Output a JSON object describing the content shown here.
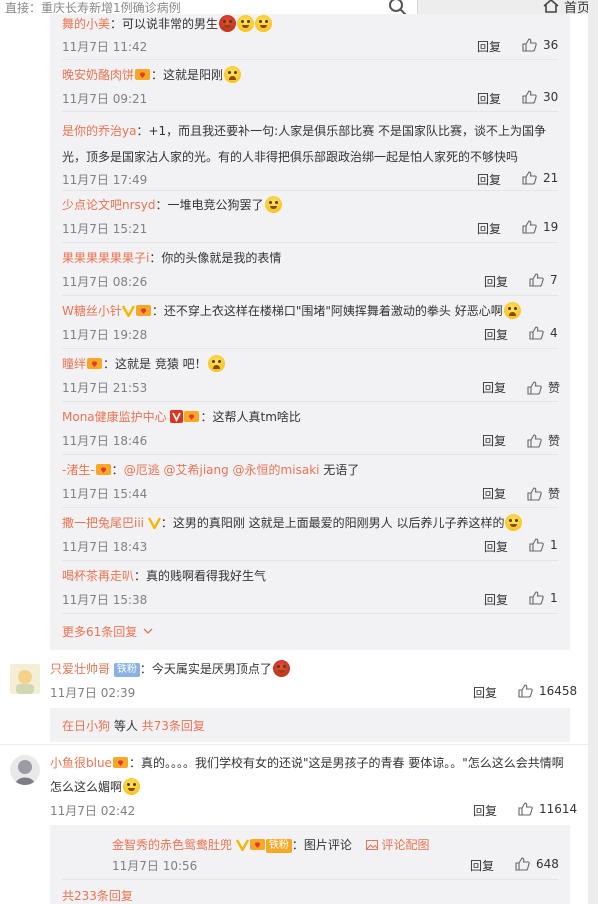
{
  "search": {
    "placeholder": "直接：重庆长寿新增1例确诊病例"
  },
  "header": {
    "home_label": "首页"
  },
  "reply_label": "回复",
  "replies": [
    {
      "user": "舞的小美",
      "text": "：可以说非常的男生",
      "time": "11月7日 11:42",
      "likes": "36"
    },
    {
      "user": "晚安奶酪肉饼",
      "text": "：这就是阳刚",
      "time": "11月7日 09:21",
      "likes": "30"
    },
    {
      "user": "是你的乔治ya",
      "text": "：+1，而且我还要补一句:人家是俱乐部比赛 不是国家队比赛，谈不上为国争光，顶多是国家沾人家的光。有的人非得把俱乐部跟政治绑一起是怕人家死的不够快吗",
      "time": "11月7日 17:49",
      "likes": "21"
    },
    {
      "user": "少点论文吧nrsyd",
      "text": "：一堆电竞公狗罢了",
      "time": "11月7日 15:21",
      "likes": "19"
    },
    {
      "user": "果果果果果果子i",
      "text": "：你的头像就是我的表情",
      "time": "11月7日 08:26",
      "likes": "7"
    },
    {
      "user": "W糖丝小针",
      "text": "：还不穿上衣这样在楼梯口\"围堵\"阿姨挥舞着激动的拳头 好恶心啊",
      "time": "11月7日 19:28",
      "likes": "4"
    },
    {
      "user": "瞳绊",
      "text": "：这就是 竞猿 吧！",
      "time": "11月7日 21:53",
      "likes": "赞"
    },
    {
      "user": "Mona健康监护中心",
      "text": "：这帮人真tm啥比",
      "time": "11月7日 18:46",
      "likes": "赞"
    },
    {
      "user": "-渚生-",
      "text": "：",
      "mentions": "@厄逃 @艾希jiang @永恒的misaki",
      "tail": " 无语了",
      "time": "11月7日 15:44",
      "likes": "赞"
    },
    {
      "user": "撒一把兔尾巴iii",
      "text": "：这男的真阳刚 这就是上面最爱的阳刚男人 以后养儿子养这样的",
      "time": "11月7日 18:43",
      "likes": "1"
    },
    {
      "user": "喝杯茶再走叭",
      "text": "：真的贱啊看得我好生气",
      "time": "11月7日 15:38",
      "likes": "1"
    }
  ],
  "more_replies_1": "更多61条回复",
  "comments": [
    {
      "user": "只爱壮帅哥",
      "badge": "铁粉",
      "text": "：今天属实是厌男顶点了",
      "time": "11月7日 02:39",
      "likes": "16458",
      "summary_user": "在日小狗",
      "summary_mid": " 等人 ",
      "summary_count": "共73条回复"
    },
    {
      "user": "小鱼很blue",
      "text": "：真的。。。。我们学校有女的还说\"这是男孩子的青春 要体谅。。\"怎么这么会共情啊怎么这么媚啊",
      "time": "11月7日 02:42",
      "likes": "11614",
      "sub_user": "金智秀的赤色鸳鸯肚兜",
      "sub_badge": "铁粉",
      "sub_text": "：图片评论",
      "sub_link": "评论配图",
      "sub_time": "11月7日 10:56",
      "sub_likes": "648",
      "more": "共233条回复"
    }
  ]
}
